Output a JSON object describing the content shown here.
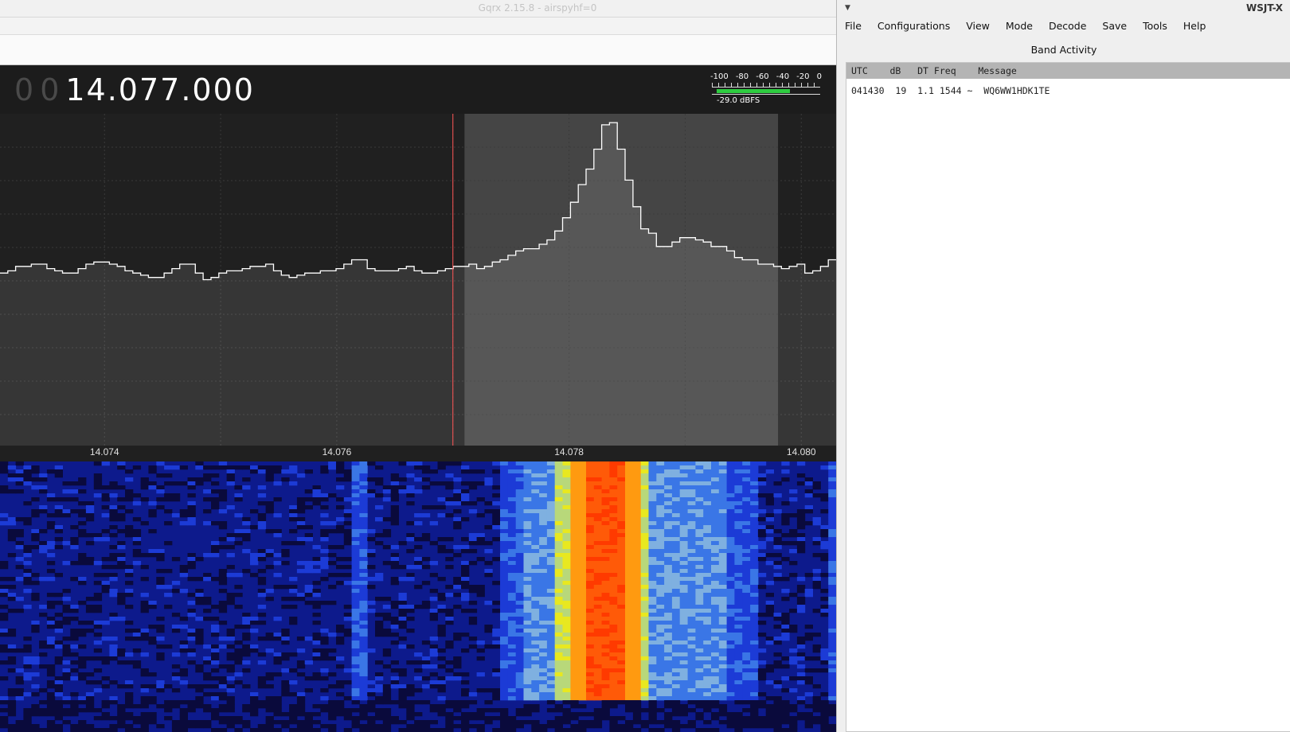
{
  "gqrx": {
    "title": "Gqrx 2.15.8 - airspyhf=0",
    "frequency": {
      "leading_zeros": [
        "0",
        "0"
      ],
      "value": "14.077.000"
    },
    "smeter": {
      "scale_labels": [
        "-100",
        "-80",
        "-60",
        "-40",
        "-20",
        "0"
      ],
      "level_fraction": 0.71,
      "readout": "-29.0 dBFS"
    },
    "spectrum": {
      "x_range_mhz": [
        14.0731,
        14.0803
      ],
      "tick_labels": [
        "14.074",
        "14.076",
        "14.078",
        "14.080"
      ],
      "tick_values": [
        14.074,
        14.076,
        14.078,
        14.08
      ],
      "demod_marker_mhz": 14.077,
      "filter_band_mhz": [
        14.0771,
        14.0798
      ],
      "trace": [
        78,
        79,
        81,
        81,
        82,
        82,
        80,
        79,
        78,
        78,
        80,
        82,
        83,
        83,
        82,
        81,
        79,
        78,
        77,
        76,
        76,
        78,
        80,
        82,
        82,
        78,
        75,
        76,
        78,
        79,
        79,
        80,
        81,
        81,
        82,
        79,
        77,
        76,
        77,
        78,
        78,
        79,
        79,
        80,
        82,
        84,
        84,
        80,
        79,
        79,
        79,
        80,
        81,
        79,
        78,
        78,
        79,
        80,
        81,
        81,
        82,
        80,
        81,
        83,
        84,
        86,
        88,
        89,
        89,
        91,
        93,
        97,
        103,
        110,
        118,
        125,
        134,
        145,
        146,
        134,
        120,
        108,
        98,
        96,
        90,
        90,
        92,
        94,
        94,
        93,
        92,
        90,
        90,
        88,
        85,
        84,
        84,
        82,
        82,
        81,
        80,
        81,
        82,
        78,
        79,
        81,
        84
      ]
    },
    "waterfall": {
      "colors": [
        "#0a0a3c",
        "#0d1a8c",
        "#1c3bd6",
        "#3a76e6",
        "#7fb0e0",
        "#b8d87a",
        "#e8e820",
        "#ff9a10",
        "#ff5a08",
        "#ff3a00"
      ]
    }
  },
  "wsjtx": {
    "title": "WSJT-X",
    "menu": [
      "File",
      "Configurations",
      "View",
      "Mode",
      "Decode",
      "Save",
      "Tools",
      "Help"
    ],
    "band_activity": {
      "title": "Band Activity",
      "columns": [
        "UTC",
        "dB",
        "DT",
        "Freq",
        "Message"
      ],
      "rows": [
        {
          "utc": "041430",
          "db": "19",
          "dt": "1.1",
          "freq": "1544",
          "sep": "~",
          "message": "WQ6WW1HDK1TE"
        }
      ]
    }
  }
}
